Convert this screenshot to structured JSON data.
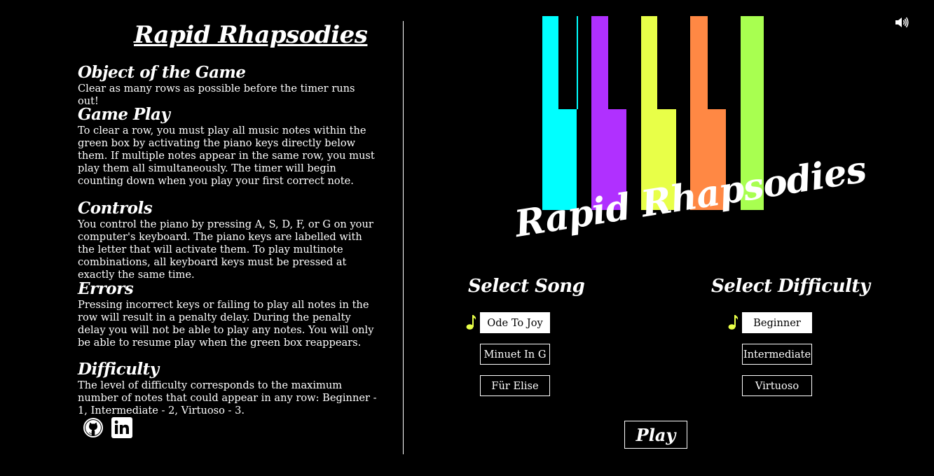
{
  "left_panel": {
    "title": "Rapid Rhapsodies",
    "sections": [
      {
        "heading": "Object of the Game",
        "body": "Clear as many rows as possible before the timer runs out!"
      },
      {
        "heading": "Game Play",
        "body": "To clear a row, you must play all music notes within the green box by activating the piano keys directly below them. If multiple notes appear in the same row, you must play them all simultaneously. The timer will begin counting down when you play your first correct note."
      },
      {
        "heading": "Controls",
        "body": "You control the piano by pressing A, S, D, F, or G on your computer's keyboard. The piano keys are labelled with the letter that will activate them. To play multinote combinations, all keyboard keys must be pressed at exactly the same time."
      },
      {
        "heading": "Errors",
        "body": "Pressing incorrect keys or failing to play all notes in the row will result in a penalty delay. During the penalty delay you will not be able to play any notes. You will only be able to resume play when the green box reappears."
      },
      {
        "heading": "Difficulty",
        "body": "The level of difficulty corresponds to the maximum number of notes that could appear in any row: Beginner - 1, Intermediate - 2, Virtuoso - 3."
      }
    ],
    "social_icons": [
      "github-icon",
      "linkedin-icon"
    ]
  },
  "logo": {
    "text": "Rapid Rhapsodies",
    "key_colors": [
      "#00ffff",
      "#b030ff",
      "#e8ff48",
      "#ff8844",
      "#a8ff50"
    ]
  },
  "sound_icon": "speaker-volume-icon",
  "song_select": {
    "heading": "Select Song",
    "options": [
      "Ode To Joy",
      "Minuet In G",
      "Für Elise"
    ],
    "selected": "Ode To Joy"
  },
  "difficulty_select": {
    "heading": "Select Difficulty",
    "options": [
      "Beginner",
      "Intermediate",
      "Virtuoso"
    ],
    "selected": "Beginner"
  },
  "play_button": "Play",
  "colors": {
    "background": "#000000",
    "text": "#ffffff",
    "note_marker": "#e8ff48"
  }
}
